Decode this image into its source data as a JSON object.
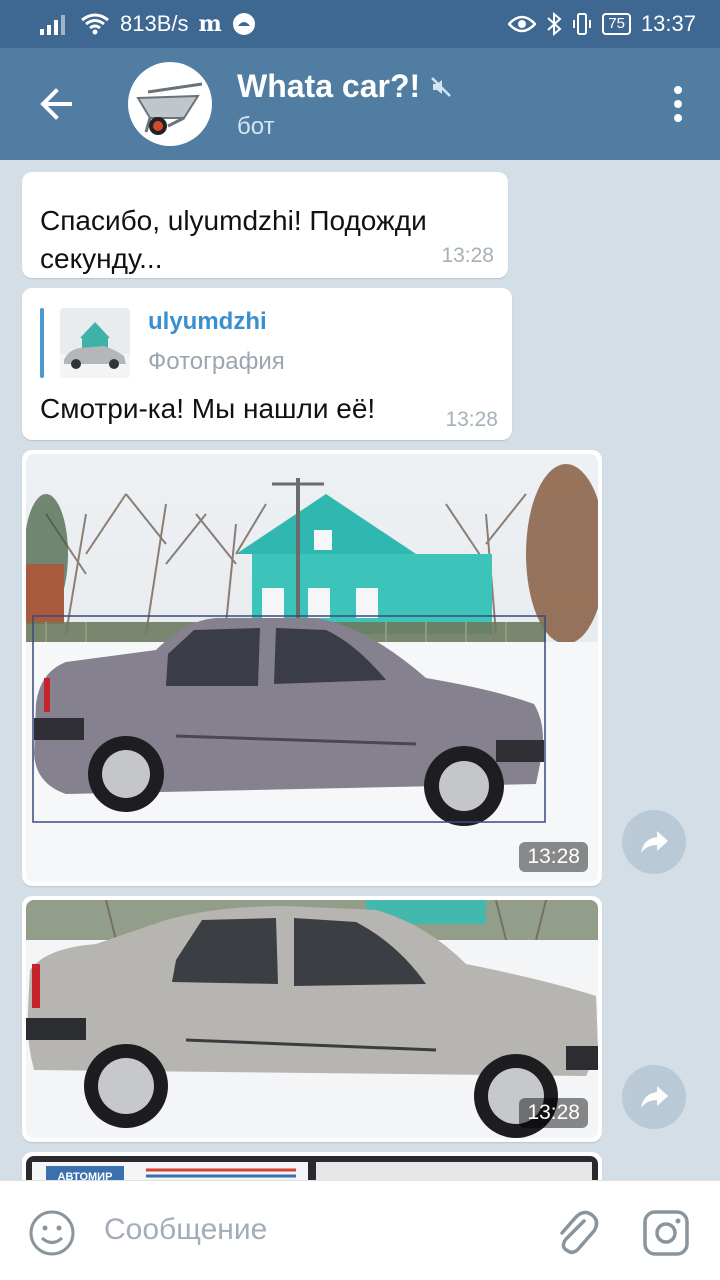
{
  "status_bar": {
    "signal_icon": "signal-icon",
    "wifi_icon": "wifi-icon",
    "speed": "813B/s",
    "app_icons": "m",
    "battery": "75",
    "time": "13:37"
  },
  "header": {
    "title": "Whata car?!",
    "subtitle": "бот",
    "muted_icon": "muted-icon",
    "colors": {
      "statusbar": "#3e6791",
      "header": "#517da2"
    }
  },
  "messages": [
    {
      "text": "Спасибо, ulyumdzhi! Подожди секунду...",
      "time": "13:28"
    },
    {
      "reply": {
        "name": "ulyumdzhi",
        "type": "Фотография"
      },
      "text": "Смотри-ка! Мы нашли её!",
      "time": "13:28"
    },
    {
      "type": "photo",
      "time": "13:28"
    },
    {
      "type": "photo",
      "time": "13:28"
    },
    {
      "type": "photo",
      "watermark": "АВТОМИР"
    }
  ],
  "input": {
    "placeholder": "Сообщение"
  }
}
